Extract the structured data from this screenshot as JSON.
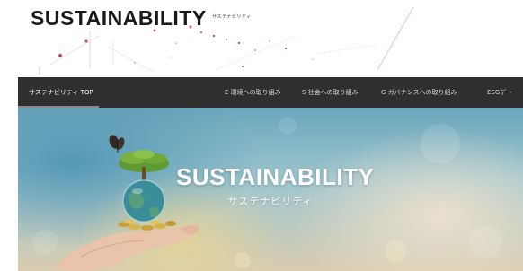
{
  "header": {
    "title": "SUSTAINABILITY",
    "subtitle": "サステナビリティ"
  },
  "nav": {
    "items": [
      {
        "label": "サステナビリティ TOP",
        "active": true
      },
      {
        "label": "E 環境への取り組み"
      },
      {
        "label": "S 社会への取り組み"
      },
      {
        "label": "G ガバナンスへの取り組み"
      },
      {
        "label": "ESGデー"
      }
    ]
  },
  "hero": {
    "title": "SUSTAINABILITY",
    "subtitle": "サステナビリティ"
  },
  "colors": {
    "nav_background": "#2f2f2f",
    "accent_dots": "#d44a5a"
  }
}
